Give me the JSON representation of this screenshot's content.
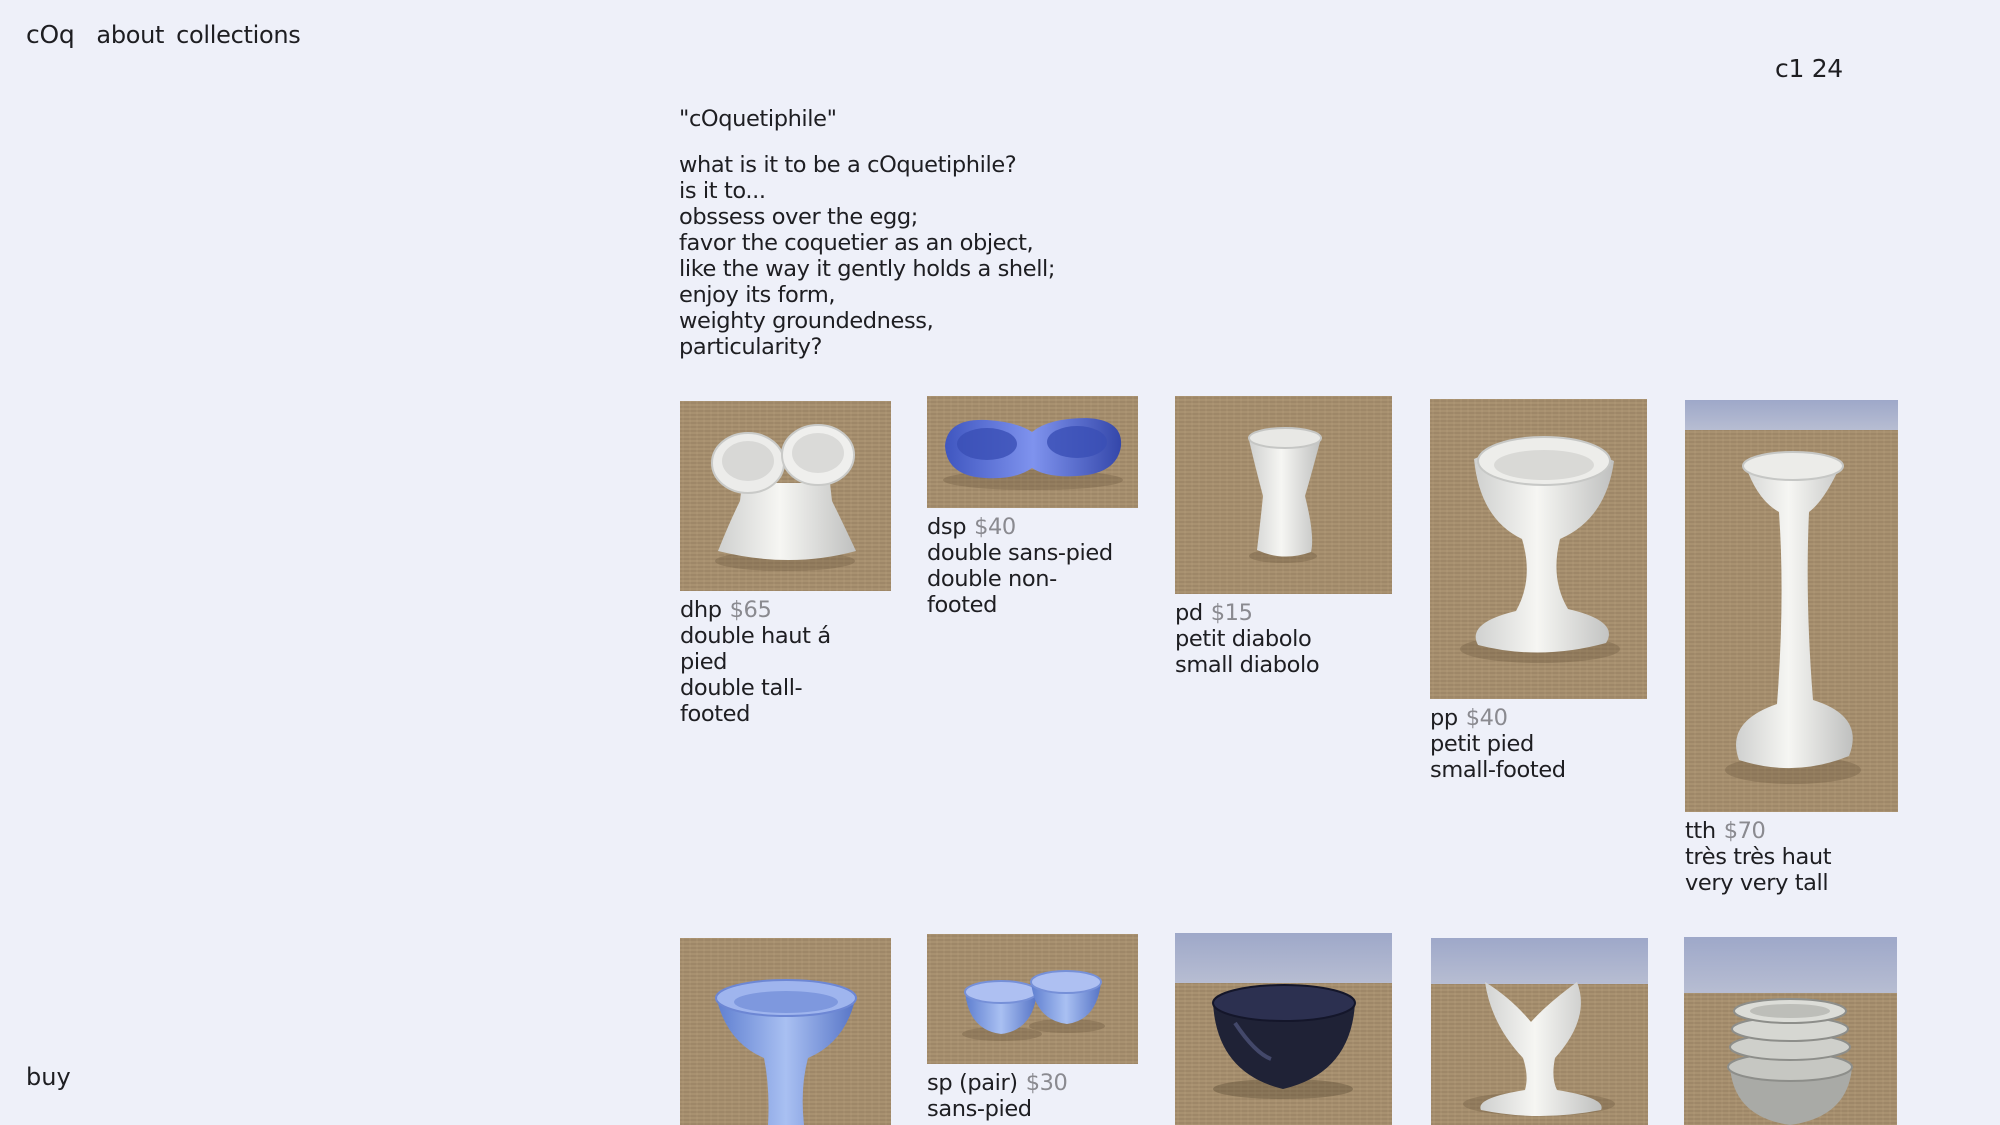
{
  "nav": {
    "logo": "cOq",
    "links": [
      "about",
      "collections"
    ]
  },
  "edition": "c1 24",
  "buy_label": "buy",
  "intro": {
    "title": "\"cOquetiphile\"",
    "lines": [
      "what is it to be a cOquetiphile?",
      "is it to...",
      "obssess over the egg;",
      "favor the coquetier as an object,",
      "like the way it gently holds a shell;",
      "enjoy its form,",
      "weighty groundedness,",
      "particularity?"
    ]
  },
  "products": [
    {
      "code": "dhp",
      "price": "$65",
      "desc1": "double haut á",
      "desc2": "pied",
      "desc3": "double tall-",
      "desc4": "footed",
      "photo": "white double tall-footed egg cup"
    },
    {
      "code": "dsp",
      "price": "$40",
      "desc1": "double sans-pied",
      "desc2": "double non-",
      "desc3": "footed",
      "photo": "blue double non-footed egg cup"
    },
    {
      "code": "pd",
      "price": "$15",
      "desc1": "petit diabolo",
      "desc2": "small diabolo",
      "photo": "white small diabolo egg cup"
    },
    {
      "code": "pp",
      "price": "$40",
      "desc1": "petit pied",
      "desc2": "small-footed",
      "photo": "white small-footed egg cup"
    },
    {
      "code": "tth",
      "price": "$70",
      "desc1": "très très haut",
      "desc2": "very very tall",
      "photo": "white very tall egg cup"
    },
    {
      "photo": "light blue footed egg cup"
    },
    {
      "code": "sp (pair)",
      "price": "$30",
      "desc1": "sans-pied",
      "photo": "pair of light blue egg cups"
    },
    {
      "photo": "black bowl egg cup"
    },
    {
      "photo": "white flared egg cup"
    },
    {
      "photo": "stack of grey egg cups"
    }
  ],
  "colors": {
    "background": "#eef0f9",
    "text": "#1e1e22",
    "price": "#8a8a90",
    "tatami": "#a89170"
  }
}
